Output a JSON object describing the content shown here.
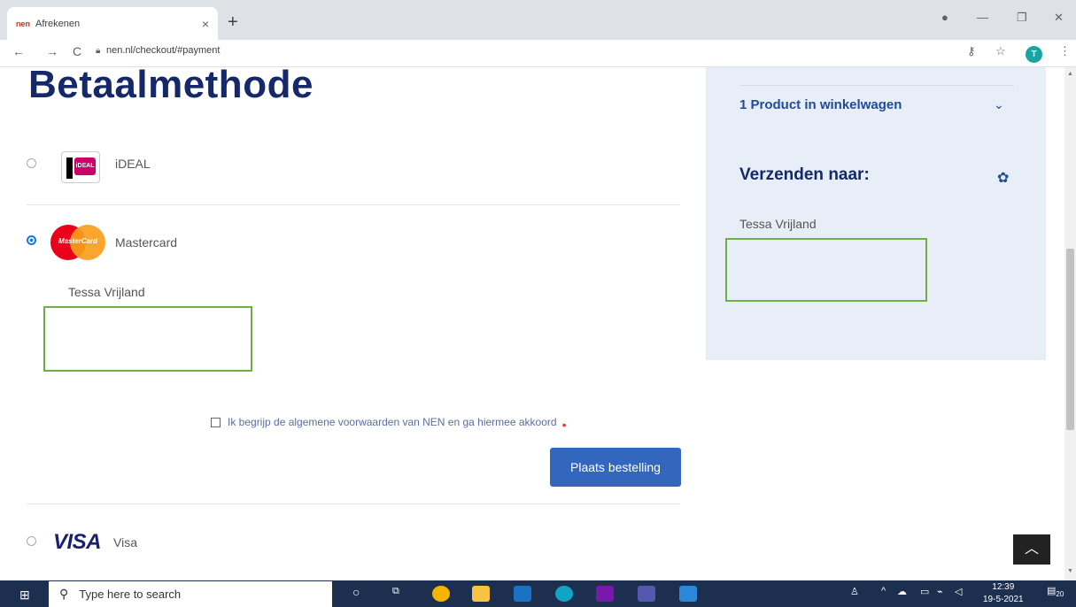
{
  "browser": {
    "tab_title": "Afrekenen",
    "tab_favicon": "nen",
    "url": "nen.nl/checkout/#payment",
    "profile_initial": "T"
  },
  "page": {
    "heading": "Betaalmethode",
    "methods": [
      {
        "label": "iDEAL",
        "logo": "ideal-logo",
        "selected": false
      },
      {
        "label": "Mastercard",
        "logo": "mastercard-logo",
        "logo_text": "MasterCard",
        "selected": true
      },
      {
        "label": "Visa",
        "logo": "visa-logo",
        "logo_text": "VISA",
        "selected": false
      }
    ],
    "cardholder_name": "Tessa Vrijland",
    "terms_label": "Ik begrijp de algemene voorwaarden van NEN en ga hiermee akkoord",
    "required_mark": "•",
    "order_button": "Plaats bestelling"
  },
  "sidebar": {
    "products_summary": "1 Product in winkelwagen",
    "ship_to_title": "Verzenden naar:",
    "ship_to_name": "Tessa Vrijland"
  },
  "taskbar": {
    "search_placeholder": "Type here to search",
    "time": "12:39",
    "date": "19-5-2021",
    "notification_count": "20"
  },
  "colors": {
    "heading": "#14286a",
    "button": "#3367bd",
    "sidebar_bg": "#e8eef8",
    "highlight_box": "#70ad47"
  }
}
